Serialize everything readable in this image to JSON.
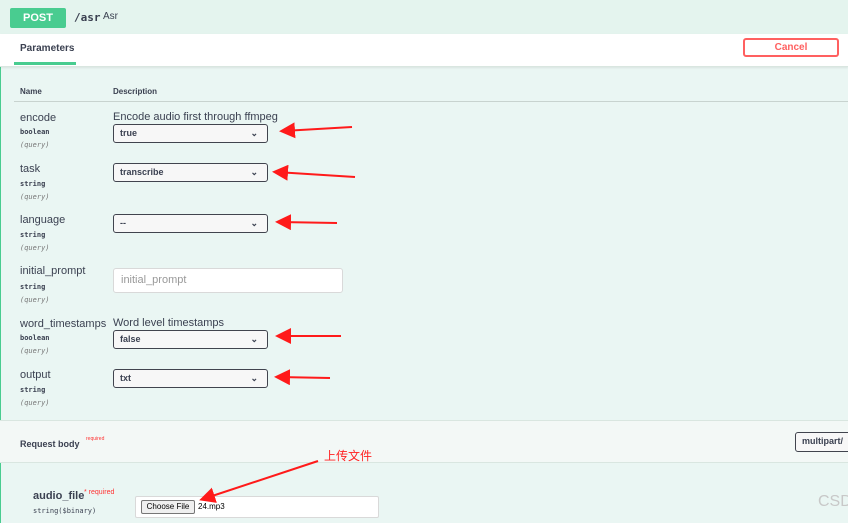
{
  "summary": {
    "method": "POST",
    "path": "/asr",
    "description": "Asr"
  },
  "header": {
    "tab_label": "Parameters",
    "cancel_label": "Cancel"
  },
  "columns": {
    "name": "Name",
    "description": "Description"
  },
  "params": [
    {
      "name": "encode",
      "type": "boolean",
      "in": "(query)",
      "description": "Encode audio first through ffmpeg",
      "value": "true"
    },
    {
      "name": "task",
      "type": "string",
      "in": "(query)",
      "description": "",
      "value": "transcribe"
    },
    {
      "name": "language",
      "type": "string",
      "in": "(query)",
      "description": "",
      "value": "--"
    },
    {
      "name": "initial_prompt",
      "type": "string",
      "in": "(query)",
      "description": "",
      "placeholder": "initial_prompt"
    },
    {
      "name": "word_timestamps",
      "type": "boolean",
      "in": "(query)",
      "description": "Word level timestamps",
      "value": "false"
    },
    {
      "name": "output",
      "type": "string",
      "in": "(query)",
      "description": "",
      "value": "txt"
    }
  ],
  "request_body": {
    "title": "Request body",
    "required": "required",
    "content_type": "multipart/"
  },
  "audio_file": {
    "name": "audio_file",
    "star": "* required",
    "type": "string($binary)",
    "button": "Choose File",
    "file_name": "24.mp3"
  },
  "annotation": "上传文件",
  "watermark": "CSD",
  "colors": {
    "post": "#49cc90",
    "cancel": "#ff6060",
    "arrow": "#ff1a1a"
  }
}
